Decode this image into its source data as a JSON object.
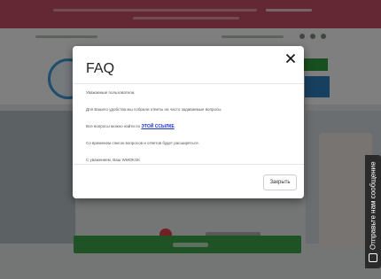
{
  "modal": {
    "title": "FAQ",
    "greeting": "Уважаемые пользователи,",
    "intro": "Для Вашего удобства мы собрали ответы на часто задаваемые вопросы",
    "link_prefix": "Все вопросы можно найти по",
    "link_text": "ЭТОЙ ССЫЛКЕ",
    "link_suffix": ".",
    "note": "Со временем список вопросов и ответов будет расширяться.",
    "signature": "С уважением, Ваш WMOKSK",
    "close_button": "Закрыть",
    "close_icon": "close-icon"
  },
  "side_tab": {
    "label": "Отправьте нам сообщение",
    "icon": "chat-icon"
  },
  "colors": {
    "overlay": "rgba(0,0,0,0.5)",
    "link": "#1a33c8",
    "banner": "#c8506a",
    "cta": "#3fa64a",
    "side_tab": "#2b2b2b"
  }
}
